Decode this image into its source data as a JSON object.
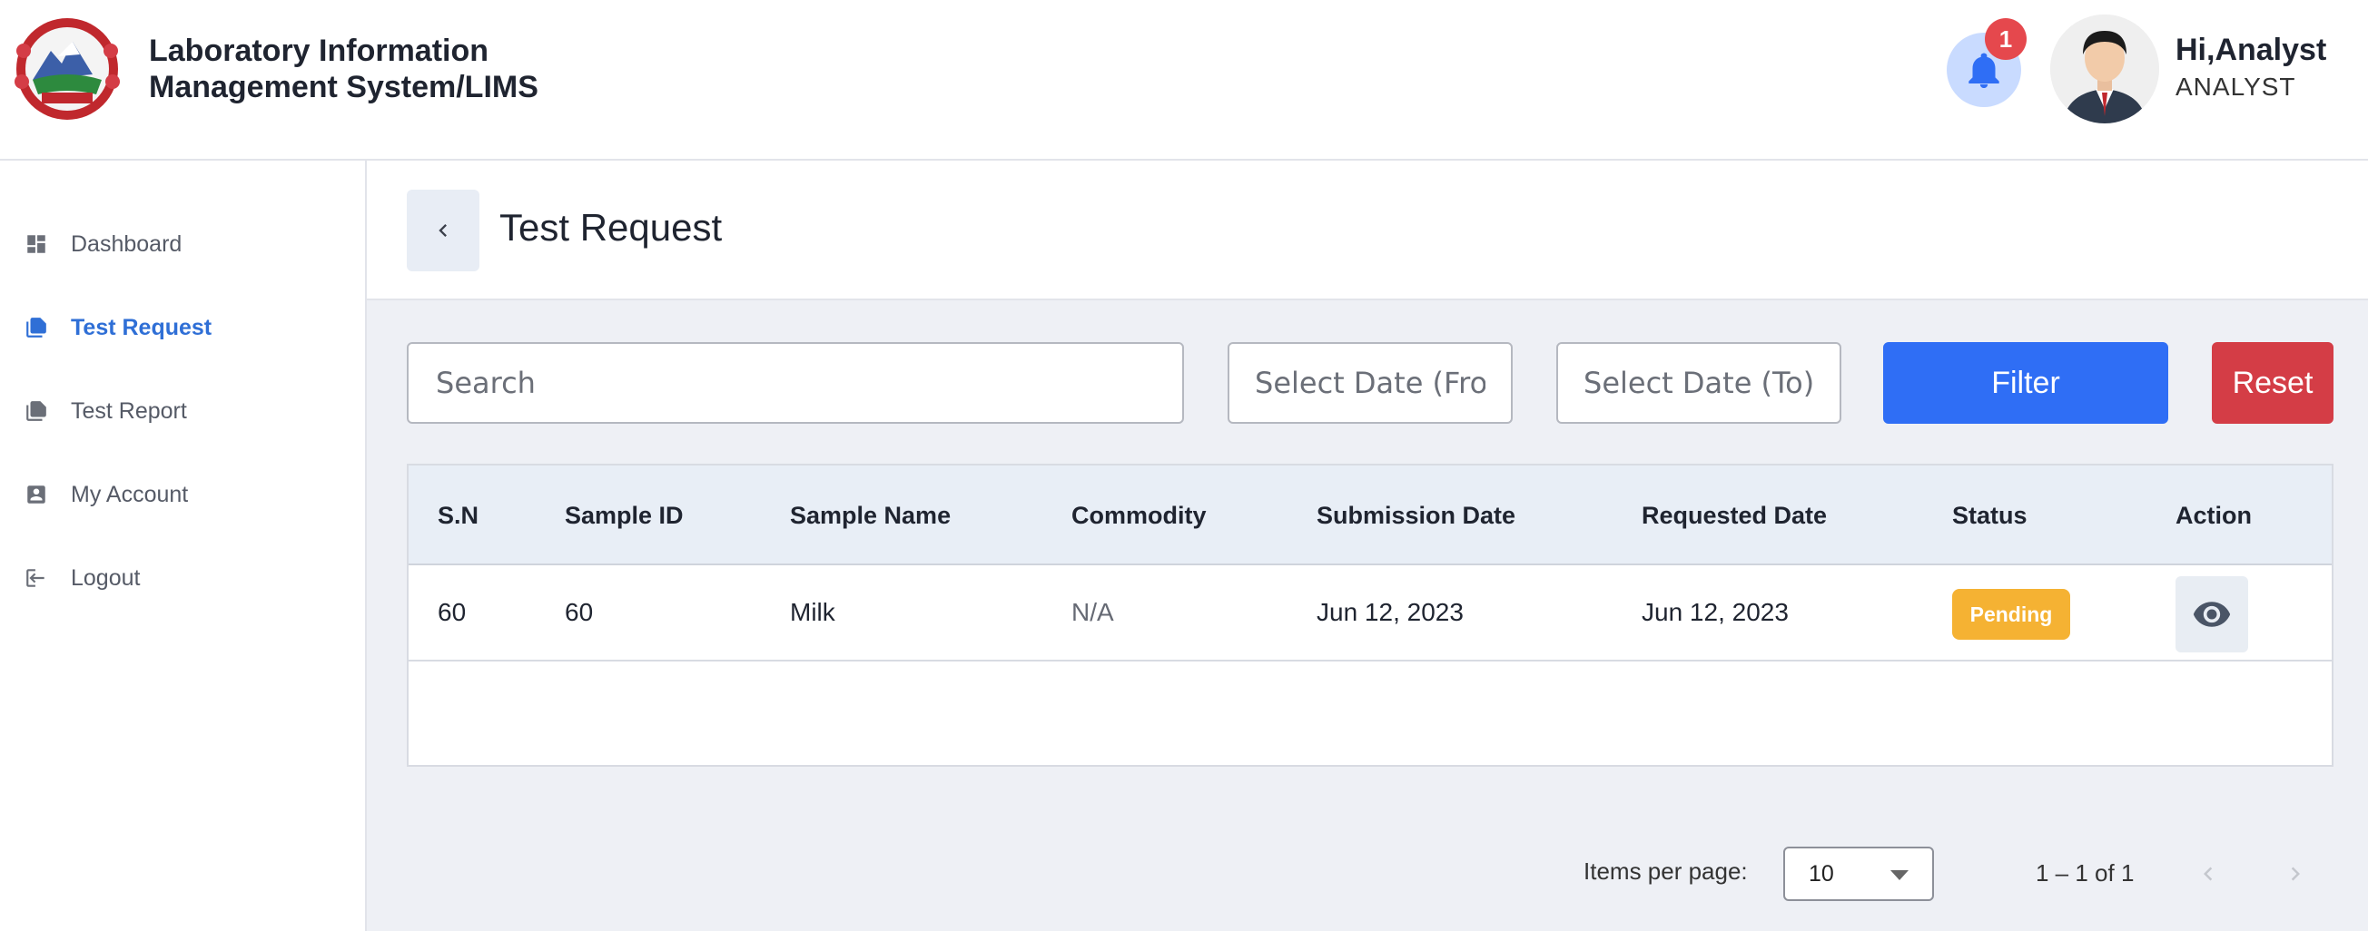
{
  "app": {
    "title_line1": "Laboratory Information",
    "title_line2": "Management System/LIMS"
  },
  "user": {
    "greeting": "Hi,Analyst",
    "role": "ANALYST",
    "notification_count": "1"
  },
  "sidebar": {
    "items": [
      {
        "label": "Dashboard",
        "icon": "dashboard-icon",
        "active": false
      },
      {
        "label": "Test Request",
        "icon": "document-copy-icon",
        "active": true
      },
      {
        "label": "Test Report",
        "icon": "document-copy-icon",
        "active": false
      },
      {
        "label": "My Account",
        "icon": "account-box-icon",
        "active": false
      },
      {
        "label": "Logout",
        "icon": "logout-icon",
        "active": false
      }
    ]
  },
  "page": {
    "title": "Test Request"
  },
  "filters": {
    "search_placeholder": "Search",
    "date_from_placeholder": "Select Date (From)",
    "date_to_placeholder": "Select Date (To)",
    "filter_label": "Filter",
    "reset_label": "Reset"
  },
  "table": {
    "headers": [
      "S.N",
      "Sample ID",
      "Sample Name",
      "Commodity",
      "Submission Date",
      "Requested Date",
      "Status",
      "Action"
    ],
    "rows": [
      {
        "sn": "60",
        "sample_id": "60",
        "sample_name": "Milk",
        "commodity": "N/A",
        "submission_date": "Jun 12, 2023",
        "requested_date": "Jun 12, 2023",
        "status": "Pending"
      }
    ]
  },
  "pagination": {
    "items_per_page_label": "Items per page:",
    "items_per_page_value": "10",
    "range_label": "1 – 1 of 1"
  },
  "colors": {
    "primary": "#2f6ef5",
    "danger": "#d43d46",
    "pending": "#f5b233",
    "active_nav": "#2f6fd6"
  }
}
